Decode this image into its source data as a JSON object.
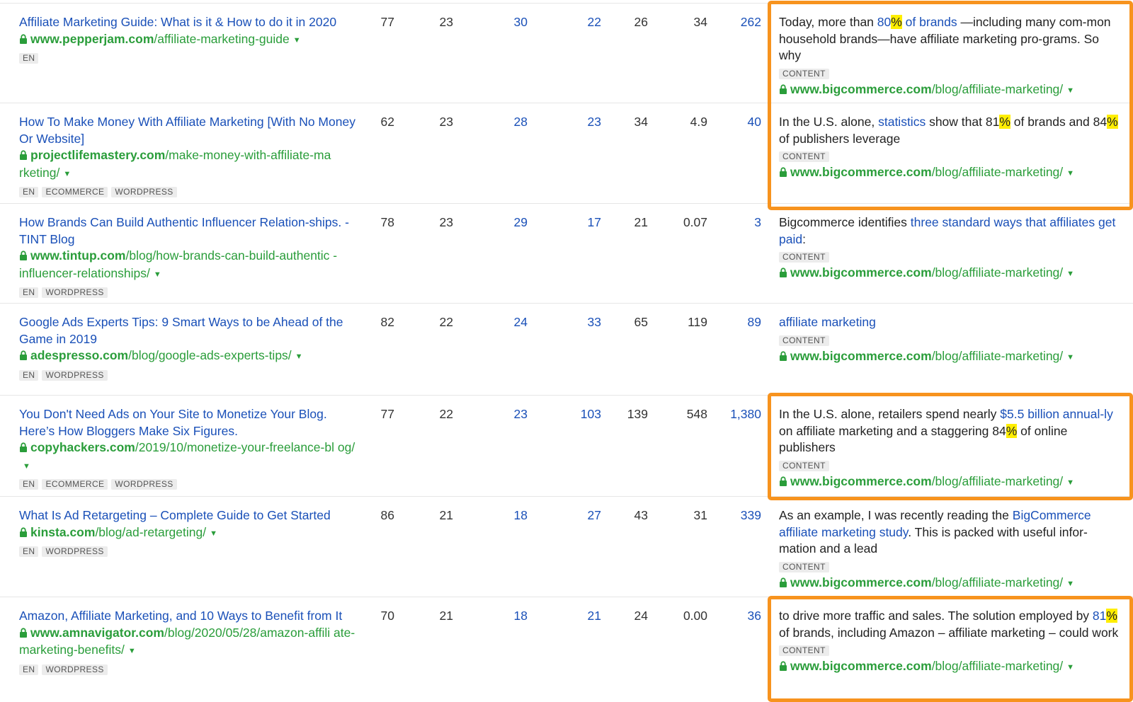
{
  "rows": [
    {
      "title": "Affiliate Marketing Guide: What is it & How to do it in 2020",
      "url_domain": "www.pepperjam.com",
      "url_path": "/affiliate-marketing-guide",
      "tags": [
        "EN"
      ],
      "metrics": [
        "77",
        "23",
        "30",
        "22",
        "26",
        "34",
        "262"
      ],
      "ctx_pre": "Today, more than ",
      "ctx_link": "80",
      "ctx_pct": "%",
      "ctx_link2": " of brands",
      "ctx_post": " —including many com-mon household brands—have affiliate marketing pro-grams. So why",
      "ref_tag": "CONTENT",
      "ref_domain": "www.bigcommerce.com",
      "ref_path": "/blog/affiliate-marketing/"
    },
    {
      "title": "How To Make Money With Affiliate Marketing [With No Money Or Website]",
      "url_domain": "projectlifemastery.com",
      "url_path": "/make-money-with-affiliate-ma rketing/",
      "tags": [
        "EN",
        "ECOMMERCE",
        "WORDPRESS"
      ],
      "metrics": [
        "62",
        "23",
        "28",
        "23",
        "34",
        "4.9",
        "40"
      ],
      "ctx_pre": "In the U.S. alone, ",
      "ctx_link": "statistics",
      "ctx_mid": " show that 81",
      "ctx_pct": "%",
      "ctx_mid2": " of brands and 84",
      "ctx_pct2": "%",
      "ctx_post": " of publishers leverage",
      "ref_tag": "CONTENT",
      "ref_domain": "www.bigcommerce.com",
      "ref_path": "/blog/affiliate-marketing/"
    },
    {
      "title": "How Brands Can Build Authentic Influencer Relation-ships. - TINT Blog",
      "url_domain": "www.tintup.com",
      "url_path": "/blog/how-brands-can-build-authentic -influencer-relationships/",
      "tags": [
        "EN",
        "WORDPRESS"
      ],
      "metrics": [
        "78",
        "23",
        "29",
        "17",
        "21",
        "0.07",
        "3"
      ],
      "ctx_pre": "Bigcommerce identifies ",
      "ctx_link": "three standard ways that affiliates get paid",
      "ctx_post": ":",
      "ref_tag": "CONTENT",
      "ref_domain": "www.bigcommerce.com",
      "ref_path": "/blog/affiliate-marketing/"
    },
    {
      "title": "Google Ads Experts Tips: 9 Smart Ways to be Ahead of the Game in 2019",
      "url_domain": "adespresso.com",
      "url_path": "/blog/google-ads-experts-tips/",
      "tags": [
        "EN",
        "WORDPRESS"
      ],
      "metrics": [
        "82",
        "22",
        "24",
        "33",
        "65",
        "119",
        "89"
      ],
      "ctx_link": "affiliate marketing",
      "ref_tag": "CONTENT",
      "ref_domain": "www.bigcommerce.com",
      "ref_path": "/blog/affiliate-marketing/"
    },
    {
      "title": "You Don't Need Ads on Your Site to Monetize Your Blog. Here’s How Bloggers Make Six Figures.",
      "url_domain": "copyhackers.com",
      "url_path": "/2019/10/monetize-your-freelance-bl og/",
      "tags": [
        "EN",
        "ECOMMERCE",
        "WORDPRESS"
      ],
      "metrics": [
        "77",
        "22",
        "23",
        "103",
        "139",
        "548",
        "1,380"
      ],
      "ctx_pre": "In the U.S. alone, retailers spend nearly ",
      "ctx_link": "$5.5 billion annual-ly",
      "ctx_mid": " on affiliate marketing and a staggering 84",
      "ctx_pct": "%",
      "ctx_post": " of online publishers",
      "ref_tag": "CONTENT",
      "ref_domain": "www.bigcommerce.com",
      "ref_path": "/blog/affiliate-marketing/"
    },
    {
      "title": "What Is Ad Retargeting – Complete Guide to Get Started",
      "url_domain": "kinsta.com",
      "url_path": "/blog/ad-retargeting/",
      "tags": [
        "EN",
        "WORDPRESS"
      ],
      "metrics": [
        "86",
        "21",
        "18",
        "27",
        "43",
        "31",
        "339"
      ],
      "ctx_pre": "As an example, I was recently reading the ",
      "ctx_link": "BigCommerce affiliate marketing study",
      "ctx_post": ". This is packed with useful infor-mation and a lead",
      "ref_tag": "CONTENT",
      "ref_domain": "www.bigcommerce.com",
      "ref_path": "/blog/affiliate-marketing/"
    },
    {
      "title": "Amazon, Affiliate Marketing, and 10 Ways to Benefit from It",
      "url_domain": "www.amnavigator.com",
      "url_path": "/blog/2020/05/28/amazon-affili ate-marketing-benefits/",
      "tags": [
        "EN",
        "WORDPRESS"
      ],
      "metrics": [
        "70",
        "21",
        "18",
        "21",
        "24",
        "0.00",
        "36"
      ],
      "ctx_pre": "to drive more traffic and sales. The solution employed by ",
      "ctx_link": "81",
      "ctx_pct": "%",
      "ctx_post": " of brands, including Amazon – affiliate marketing – could work",
      "ref_tag": "CONTENT",
      "ref_domain": "www.bigcommerce.com",
      "ref_path": "/blog/affiliate-marketing/"
    }
  ],
  "colors": {
    "link_blue": "#1a50b8",
    "url_green": "#2a9d3a",
    "highlight_yellow": "#ffee00",
    "callout_orange": "#f7931e"
  },
  "icons": {
    "lock": "lock-icon",
    "caret": "caret-down-icon"
  }
}
